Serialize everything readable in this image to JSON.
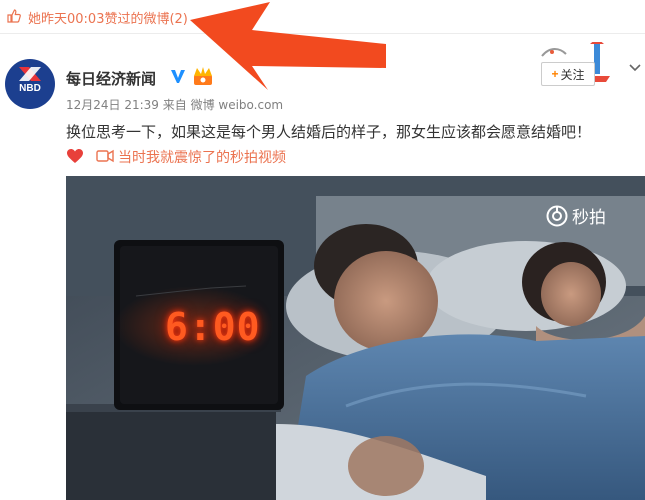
{
  "liked_notice": {
    "text": "她昨天00:03赞过的微博(2)",
    "icon": "thumbs-up-icon"
  },
  "post": {
    "author": {
      "name": "每日经济新闻",
      "avatar_text": "NBD",
      "verified_icon": "verified-v-icon",
      "badge_icon": "crown-icon"
    },
    "follow_label": "关注",
    "meta": "12月24日 21:39 来自 微博 weibo.com",
    "text": "换位思考一下，如果这是每个男人结婚后的样子，那女生应该都会愿意结婚吧！",
    "video_link": "当时我就震惊了的秒拍视频"
  },
  "media": {
    "watermark": "秒拍",
    "clock_time": "6:00"
  },
  "colors": {
    "accent_orange": "#eb7350",
    "follow_plus": "#ff8200",
    "arrow_red": "#f24a1f",
    "avatar_blue": "#1c3f8f"
  }
}
